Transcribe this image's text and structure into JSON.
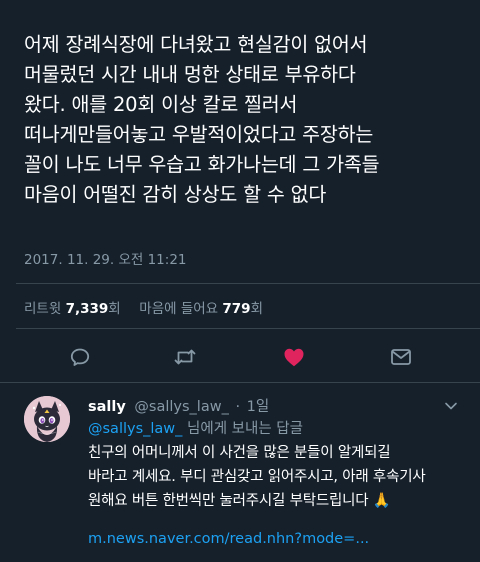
{
  "tweet": {
    "lines": [
      "어제 장례식장에 다녀왔고 현실감이 없어서",
      "머물렀던 시간 내내 멍한 상태로 부유하다",
      "왔다.  애를 20회 이상 칼로 찔러서",
      "떠나게만들어놓고 우발적이었다고 주장하는",
      "꼴이 나도 너무 우습고 화가나는데 그 가족들",
      "마음이 어떨진 감히 상상도 할 수 없다"
    ],
    "timestamp": "2017. 11. 29. 오전 11:21"
  },
  "stats": {
    "retweet_label": "리트윗",
    "retweet_count": "7,339",
    "retweet_unit": "회",
    "like_label": "마음에 들어요",
    "like_count": "779",
    "like_unit": "회"
  },
  "actions": {
    "reply_icon": "reply-icon",
    "retweet_icon": "retweet-icon",
    "like_icon": "heart-icon",
    "message_icon": "envelope-icon",
    "like_color": "#e0245e",
    "icon_color": "#8899a6"
  },
  "reply": {
    "name": "sally",
    "handle": "@sallys_law_",
    "dot": "·",
    "time": "1일",
    "reply_to_mention": "@sallys_law_",
    "reply_to_rest": " 님에게 보내는 답글",
    "lines": [
      "친구의 어머니께서 이 사건을 많은 분들이 알게되길",
      "바라고 계세요. 부디 관심갖고 읽어주시고, 아래 후속기사",
      "원해요 버튼 한번씩만 눌러주시길 부탁드립니다 🙏"
    ],
    "link": "m.news.naver.com/read.nhn?mode=..."
  },
  "colors": {
    "background": "#15202b",
    "divider": "#38444d",
    "secondary_text": "#8899a6",
    "link": "#1da1f2"
  }
}
